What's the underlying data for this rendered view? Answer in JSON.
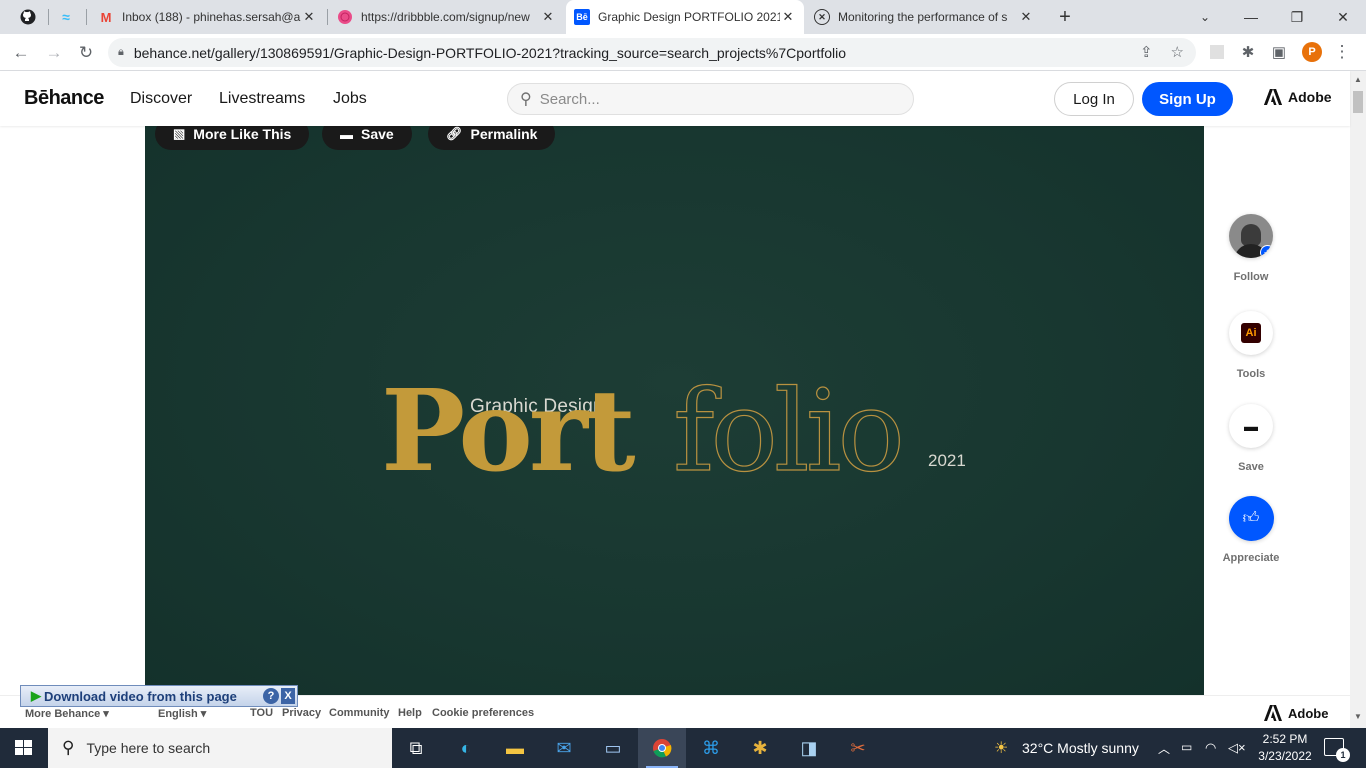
{
  "browser": {
    "tabs": [
      {
        "favicon": "github-icon",
        "title": ""
      },
      {
        "favicon": "tailwind-icon",
        "title": ""
      },
      {
        "favicon": "gmail-icon",
        "title": "Inbox (188) - phinehas.sersah@a"
      },
      {
        "favicon": "dribbble-icon",
        "title": "https://dribbble.com/signup/new"
      },
      {
        "favicon": "behance-icon",
        "title": "Graphic Design PORTFOLIO 2021"
      },
      {
        "favicon": "x-circle-icon",
        "title": "Monitoring the performance of s"
      }
    ],
    "url": "behance.net/gallery/130869591/Graphic-Design-PORTFOLIO-2021?tracking_source=search_projects%7Cportfolio",
    "profile_initial": "P"
  },
  "behance": {
    "logo": "Bēhance",
    "nav": [
      "Discover",
      "Livestreams",
      "Jobs"
    ],
    "search_placeholder": "Search...",
    "login": "Log In",
    "signup": "Sign Up",
    "adobe": "Adobe"
  },
  "project": {
    "actions": [
      "More Like This",
      "Save",
      "Permalink"
    ],
    "subtitle": "Graphic Design",
    "title_part1": "Port",
    "title_part2": "folio",
    "year": "2021",
    "colors": {
      "background": "#183730",
      "gold": "#c39a3a"
    }
  },
  "rail": {
    "follow": "Follow",
    "tools": "Tools",
    "tool_badge": "Ai",
    "save": "Save",
    "appreciate": "Appreciate"
  },
  "footer": {
    "more": "More Behance ▾",
    "language": "English ▾",
    "links": [
      "TOU",
      "Privacy",
      "Community",
      "Help",
      "Cookie preferences"
    ],
    "adobe": "Adobe"
  },
  "download_bar": {
    "label": "Download video from this page",
    "help": "?",
    "close": "X"
  },
  "taskbar": {
    "search_placeholder": "Type here to search",
    "weather": "32°C  Mostly sunny",
    "time": "2:52 PM",
    "date": "3/23/2022",
    "notifications": "1"
  }
}
